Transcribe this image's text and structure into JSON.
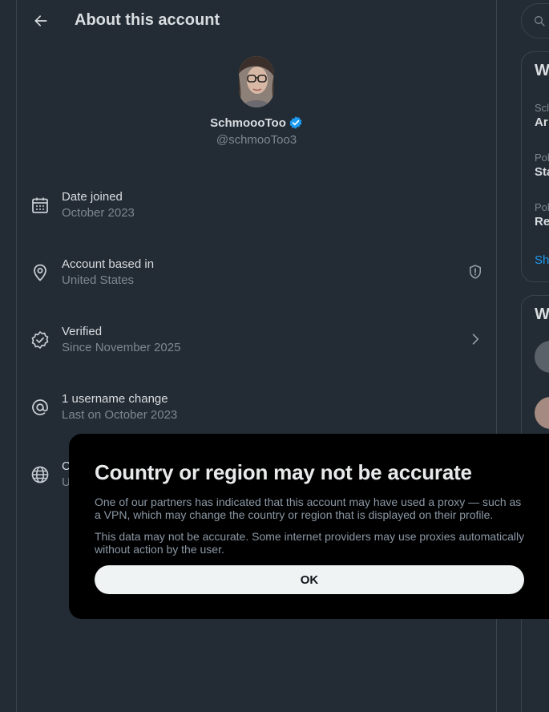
{
  "header": {
    "title": "About this account"
  },
  "profile": {
    "display_name": "SchmoooToo",
    "handle": "@schmooToo3"
  },
  "info_rows": [
    {
      "label": "Date joined",
      "value": "October 2023"
    },
    {
      "label": "Account based in",
      "value": "United States"
    },
    {
      "label": "Verified",
      "value": "Since November 2025"
    },
    {
      "label": "1 username change",
      "value": "Last on October 2023"
    },
    {
      "label": "C",
      "value": "U"
    }
  ],
  "sidebar": {
    "card1": {
      "title": "W",
      "items": [
        {
          "sub": "Scl",
          "main": "Ar"
        },
        {
          "sub": "Pol",
          "main": "Sta"
        },
        {
          "sub": "Pol",
          "main": "Re"
        }
      ],
      "link": "Sh"
    },
    "card2": {
      "title": "W"
    }
  },
  "modal": {
    "title": "Country or region may not be accurate",
    "body_1": "One of our partners has indicated that this account may have used a proxy — such as a VPN, which may change the country or region that is displayed on their profile.",
    "body_2": "This data may not be accurate. Some internet providers may use proxies automatically without action by the user.",
    "ok_label": "OK"
  },
  "colors": {
    "background": "#232b34",
    "modal_background": "#000000",
    "accent": "#1d9bf0",
    "secondary_text": "#7d8891",
    "button_bg": "#eff3f4"
  },
  "icons": [
    "back-arrow-icon",
    "verified-badge-icon",
    "calendar-icon",
    "location-pin-icon",
    "shield-info-icon",
    "verified-outline-icon",
    "chevron-right-icon",
    "at-sign-icon",
    "globe-icon",
    "search-icon"
  ]
}
